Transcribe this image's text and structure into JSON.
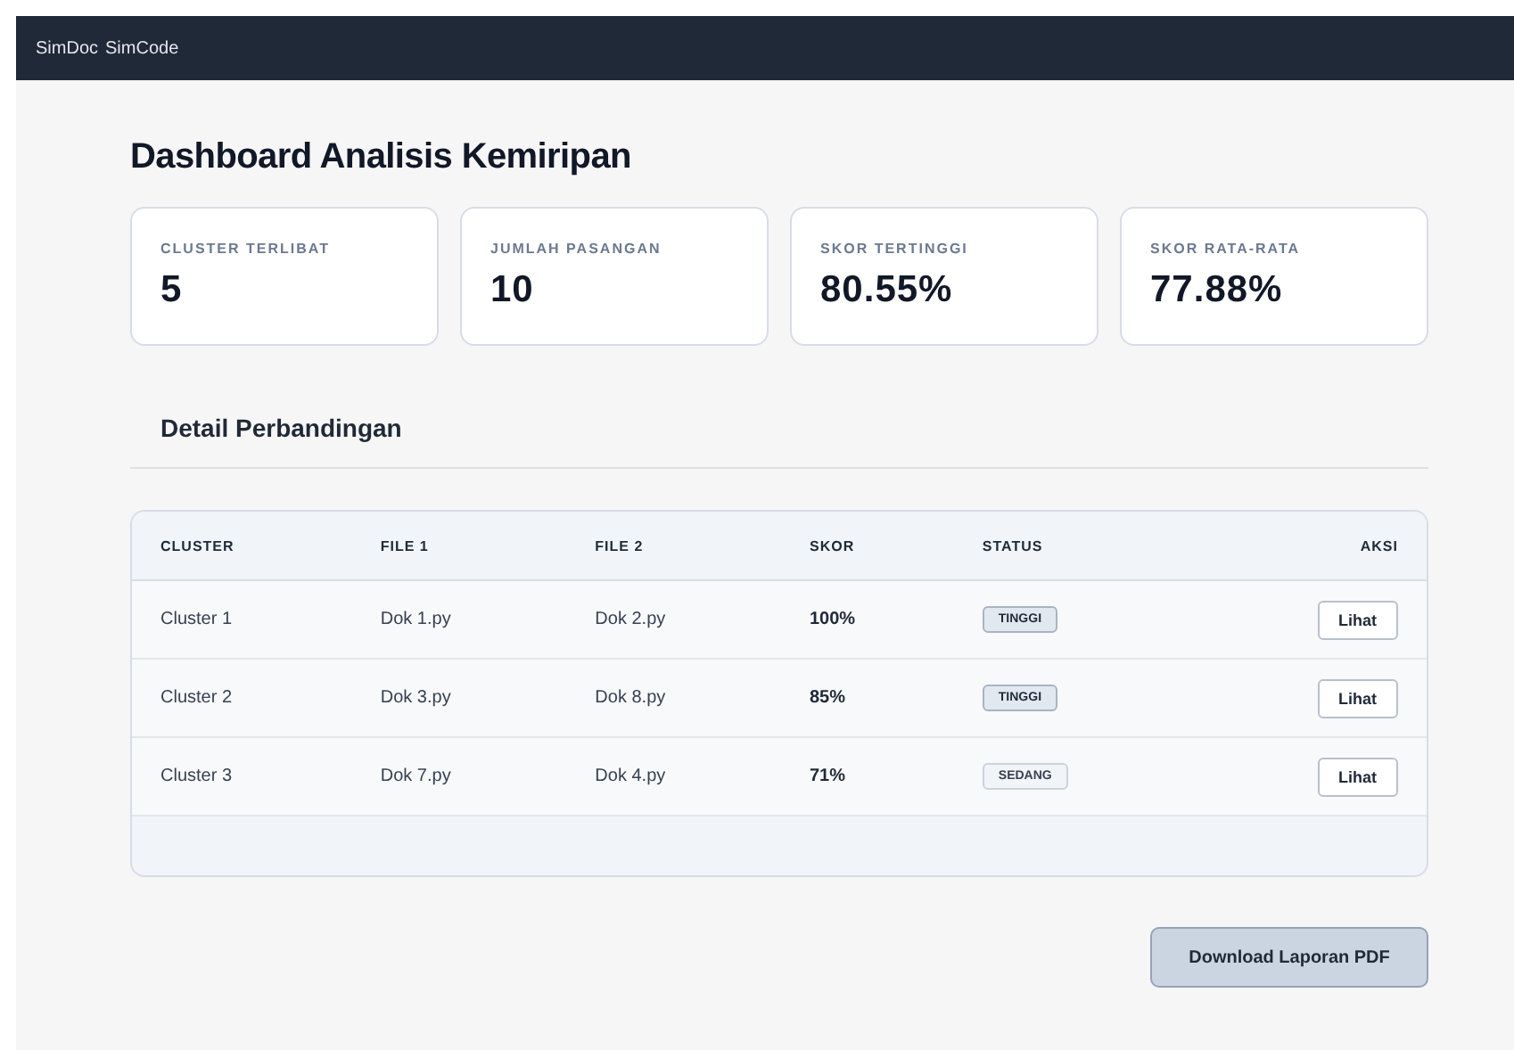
{
  "navbar": {
    "brand": "SimDoc",
    "link": "SimCode"
  },
  "title": "Dashboard Analisis Kemiripan",
  "stats": [
    {
      "label": "CLUSTER TERLIBAT",
      "value": "5"
    },
    {
      "label": "JUMLAH PASANGAN",
      "value": "10"
    },
    {
      "label": "SKOR TERTINGGI",
      "value": "80.55%"
    },
    {
      "label": "SKOR RATA-RATA",
      "value": "77.88%"
    }
  ],
  "section_title": "Detail Perbandingan",
  "table": {
    "columns": [
      "CLUSTER",
      "FILE 1",
      "FILE 2",
      "SKOR",
      "STATUS",
      "AKSI"
    ],
    "rows": [
      {
        "cluster": "Cluster 1",
        "file1": "Dok 1.py",
        "file2": "Dok 2.py",
        "score": "100%",
        "status": {
          "kind": "high",
          "label": "TINGGI"
        },
        "action": "Lihat"
      },
      {
        "cluster": "Cluster 2",
        "file1": "Dok 3.py",
        "file2": "Dok 8.py",
        "score": "85%",
        "status": {
          "kind": "high",
          "label": "TINGGI"
        },
        "action": "Lihat"
      },
      {
        "cluster": "Cluster 3",
        "file1": "Dok 7.py",
        "file2": "Dok 4.py",
        "score": "71%",
        "status": {
          "kind": "medium",
          "label": "SEDANG"
        },
        "action": "Lihat"
      }
    ]
  },
  "download_button": "Download Laporan PDF"
}
